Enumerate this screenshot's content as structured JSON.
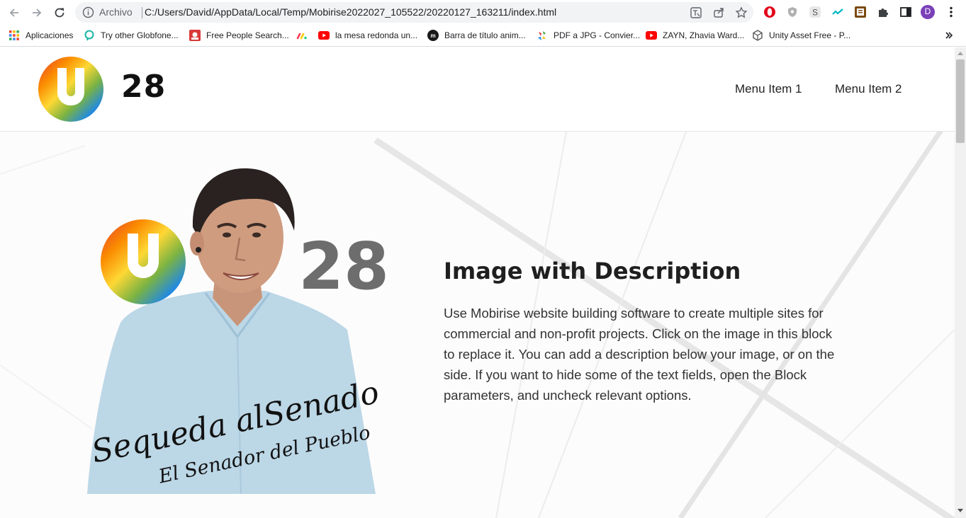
{
  "browser": {
    "scheme_label": "Archivo",
    "url": "C:/Users/David/AppData/Local/Temp/Mobirise2022027_105522/20220127_163211/index.html",
    "profile_initial": "D",
    "colors": {
      "accent": "#7b3fb8",
      "omnibox": "#f1f3f4"
    }
  },
  "bookmarks": [
    {
      "label": "Aplicaciones",
      "icon": "apps-grid-icon"
    },
    {
      "label": "Try other Globfone...",
      "icon": "globfone-icon"
    },
    {
      "label": "Free People Search...",
      "icon": "people-search-icon"
    },
    {
      "label": "",
      "icon": "monday-icon"
    },
    {
      "label": "la mesa redonda un...",
      "icon": "youtube-icon"
    },
    {
      "label": "Barra de título anim...",
      "icon": "medium-icon"
    },
    {
      "label": "PDF a JPG - Convier...",
      "icon": "pdf-converter-icon"
    },
    {
      "label": "ZAYN, Zhavia Ward...",
      "icon": "youtube-icon"
    },
    {
      "label": "Unity Asset Free - P...",
      "icon": "unity-icon"
    }
  ],
  "site": {
    "brand_name": "28",
    "menu": [
      "Menu Item 1",
      "Menu Item 2"
    ],
    "hero": {
      "title": "Image with Description",
      "text": "Use Mobirise website building software to create multiple sites for commercial and non-profit projects. Click on the image in this block to replace it. You can add a description below your image, or on the side. If you want to hide some of the text fields, open the Block parameters, and uncheck relevant options.",
      "image": {
        "logo_number": "28",
        "slogan_line1": "Sequeda alSenado",
        "slogan_line2": "El Senador del Pueblo"
      }
    }
  }
}
